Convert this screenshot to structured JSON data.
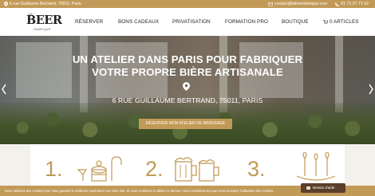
{
  "topbar": {
    "address": "6 rue Guillaume Bertrand, 75011, Paris",
    "email": "contact@labeerfabrique.com",
    "phone": "01 71 27 71 02",
    "icons": [
      "map-marker-icon",
      "envelope-icon",
      "phone-icon"
    ]
  },
  "logo": {
    "le": "LE",
    "word": "BEER",
    "sub": "FABRIQUE"
  },
  "nav": {
    "items": [
      "RÉSERVER",
      "BONS CADEAUX",
      "PRIVATISATION",
      "FORMATION PRO",
      "BOUTIQUE"
    ],
    "cart": "0 ARTICLES"
  },
  "hero": {
    "title_line1": "UN ATELIER DANS PARIS POUR FABRIQUER",
    "title_line2": "VOTRE PROPRE BIÈRE ARTISANALE",
    "address": "6 RUE GUILLAUME BERTRAND, 75011, PARIS",
    "cta": "RÉSERVER MON ATELIER DE BRASSAGE"
  },
  "steps": {
    "numbers": [
      "1.",
      "2.",
      "3."
    ],
    "icons": [
      "brewing-equipment-icon",
      "beer-mugs-icon",
      "candles-icon"
    ]
  },
  "cookie": {
    "text": "Nous utilisons des cookies pour vous garantir la meilleure expérience sur notre site. Si vous continuez à utiliser ce dernier, nous considérerons que vous acceptez l'utilisation des cookies."
  },
  "help": {
    "label": "Besoin d'aide"
  },
  "colors": {
    "accent": "#c29a57",
    "help_button": "#5b3e2a"
  }
}
